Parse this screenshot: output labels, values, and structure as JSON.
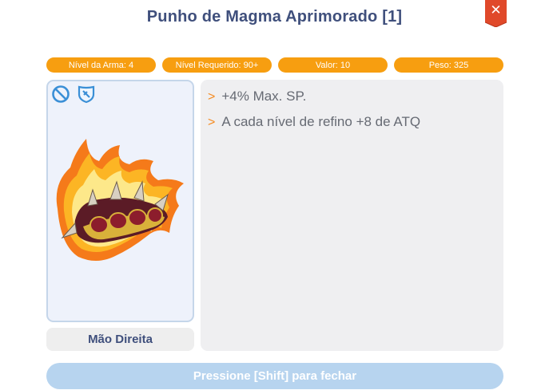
{
  "window": {
    "title": "Punho de Magma Aprimorado [1]",
    "close_label": "✕"
  },
  "stats": [
    {
      "label": "Nível da Arma: 4"
    },
    {
      "label": "Nível Requerido: 90+"
    },
    {
      "label": "Valor: 10"
    },
    {
      "label": "Peso: 325"
    }
  ],
  "item": {
    "badges": [
      "no-trade-icon",
      "shield-icon"
    ],
    "image": "magma-knuckle-weapon-icon",
    "slot_label": "Mão Direita"
  },
  "description": {
    "marker": ">",
    "lines": [
      {
        "text": "+4% Max. SP."
      },
      {
        "text": "A cada nível de refino +8 de ATQ"
      }
    ]
  },
  "footer": {
    "close_hint": "Pressione [Shift] para fechar"
  },
  "colors": {
    "accent_orange": "#f79e10",
    "title_navy": "#3f4f7c",
    "close_red": "#e0492a",
    "footer_blue": "#b7d4ef"
  }
}
